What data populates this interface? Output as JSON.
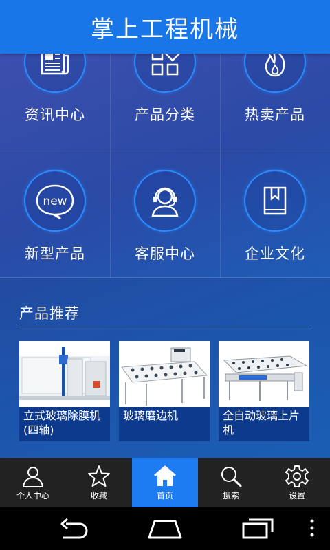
{
  "header": {
    "title": "掌上工程机械"
  },
  "grid": [
    {
      "label": "资讯中心",
      "icon": "newspaper-icon"
    },
    {
      "label": "产品分类",
      "icon": "categories-icon"
    },
    {
      "label": "热卖产品",
      "icon": "flame-icon"
    },
    {
      "label": "新型产品",
      "icon": "new-badge-icon"
    },
    {
      "label": "客服中心",
      "icon": "headset-agent-icon"
    },
    {
      "label": "企业文化",
      "icon": "book-icon"
    }
  ],
  "recommend": {
    "title": "产品推荐",
    "products": [
      {
        "name": "立式玻璃除膜机(四轴)"
      },
      {
        "name": "玻璃磨边机"
      },
      {
        "name": "全自动玻璃上片机"
      }
    ]
  },
  "tabbar": {
    "items": [
      {
        "label": "个人中心",
        "icon": "user-icon"
      },
      {
        "label": "收藏",
        "icon": "star-icon"
      },
      {
        "label": "首页",
        "icon": "home-icon",
        "active": true
      },
      {
        "label": "搜索",
        "icon": "search-icon"
      },
      {
        "label": "设置",
        "icon": "gear-icon"
      }
    ]
  },
  "colors": {
    "header": "#1976e8",
    "active_tab": "#1e7cf2",
    "caption_bg": "#0d3a8c"
  }
}
